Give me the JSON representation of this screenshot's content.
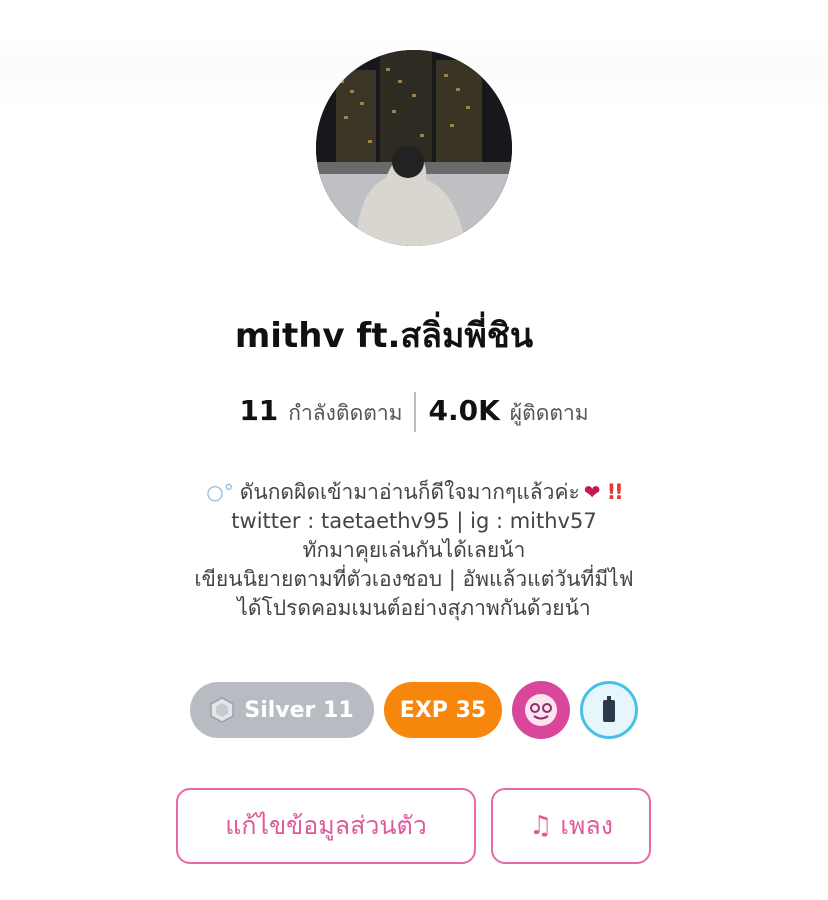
{
  "profile": {
    "name": "mithv ft.สลิ่มพี่ชิน",
    "avatar_icon": "profile-photo"
  },
  "stats": {
    "following_count": "11",
    "following_label": "กำลังติดตาม",
    "followers_count": "4.0K",
    "followers_label": "ผู้ติดตาม"
  },
  "bio": {
    "line1": "ดันกดผิดเข้ามาอ่านก็ดีใจมากๆแล้วค่ะ",
    "line1_prefix_icon": "bubbles-icon",
    "line1_suffix_icons": [
      "heart-icon",
      "double-exclamation-icon"
    ],
    "line2": "twitter : taetaethv95 | ig : mithv57",
    "line3": "ทักมาคุยเล่นกันได้เลยน้า",
    "line4": "เขียนนิยายตามที่ตัวเองชอบ | อัพแล้วแต่วันที่มีไฟ",
    "line5": "ได้โปรดคอมเมนต์อย่างสุภาพกันด้วยน้า"
  },
  "badges": {
    "rank_label": "Silver 11",
    "exp_label": "EXP 35",
    "rank_color": "#b8bcc2",
    "exp_color": "#f7860d"
  },
  "actions": {
    "edit_profile_label": "แก้ไขข้อมูลส่วนตัว",
    "music_label": "เพลง",
    "accent_color": "#e0599b"
  }
}
